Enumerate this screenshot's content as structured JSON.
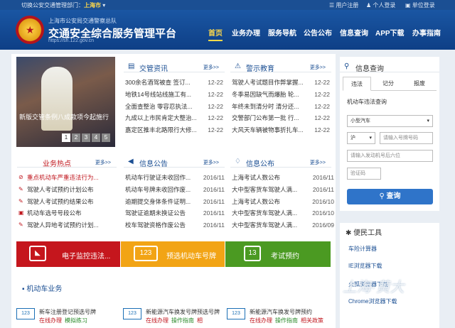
{
  "topbar": {
    "switch_label": "切换公安交通管理部门：",
    "city": "上海市",
    "links": [
      "用户注册",
      "个人登录",
      "单位登录"
    ]
  },
  "header": {
    "subtitle": "上海市公安局交通警察总队",
    "title": "交通安全综合服务管理平台",
    "url": "https://sh.122.gov.cn"
  },
  "nav": [
    "首页",
    "业务办理",
    "服务导航",
    "公告公布",
    "信息查询",
    "APP下载",
    "办事指南"
  ],
  "slider": {
    "caption": "新版交管条例八成款项今起施行",
    "pages": [
      "1",
      "2",
      "3",
      "4",
      "5"
    ]
  },
  "news": {
    "title": "交管资讯",
    "more": "更多>>",
    "rows": [
      {
        "t": "300余名酒驾被查 签订...",
        "d": "12-22"
      },
      {
        "t": "地铁14号线站线施工有...",
        "d": "12-22"
      },
      {
        "t": "全面查整治 零容忍执法...",
        "d": "12-22"
      },
      {
        "t": "九成以上市民肯定大整治...",
        "d": "12-22"
      },
      {
        "t": "嘉定区推丰北路限行大修...",
        "d": "12-22"
      }
    ]
  },
  "warn": {
    "title": "警示教育",
    "more": "更多>>",
    "rows": [
      {
        "t": "驾驶人考试题目作弊掌握...",
        "d": "12-22"
      },
      {
        "t": "冬季易因缺气而爆胎 轮...",
        "d": "12-22"
      },
      {
        "t": "年终未到清分时 清分还...",
        "d": "12-22"
      },
      {
        "t": "交警部门公布第一批 行...",
        "d": "12-22"
      },
      {
        "t": "大风天车辆被物事折扎车...",
        "d": "12-22"
      }
    ]
  },
  "hot": {
    "title": "业务热点",
    "more": "更多>>",
    "rows": [
      {
        "t": "重点机动车严重违法行为...",
        "red": true
      },
      {
        "t": "驾驶人考试预约计划公布",
        "red": false
      },
      {
        "t": "驾驶人考试预约结果公布",
        "red": false
      },
      {
        "t": "机动车选号号段公布",
        "red": false
      },
      {
        "t": "驾驶人异地考试预约计划...",
        "red": false
      }
    ]
  },
  "notice": {
    "title": "信息公告",
    "more": "更多>>",
    "rows": [
      {
        "t": "机动车行驶证未收回作...",
        "d": "2016/11"
      },
      {
        "t": "机动车号牌未收回作废...",
        "d": "2016/11"
      },
      {
        "t": "逾期提交身体条件证明...",
        "d": "2016/11"
      },
      {
        "t": "驾驶证逾期未换证公告",
        "d": "2016/11"
      },
      {
        "t": "校车驾驶资格作废公告",
        "d": "2016/11"
      }
    ]
  },
  "info": {
    "title": "信息公布",
    "more": "更多>>",
    "rows": [
      {
        "t": "上海考试人数公布",
        "d": "2016/11"
      },
      {
        "t": "大中型客货车驾驶人满...",
        "d": "2016/11"
      },
      {
        "t": "上海考试人数公布",
        "d": "2016/10"
      },
      {
        "t": "大中型客货车驾驶人满...",
        "d": "2016/10"
      },
      {
        "t": "大中型客货车驾驶人满...",
        "d": "2016/09"
      }
    ]
  },
  "banners": [
    "电子监控违法...",
    "预选机动车号牌",
    "考试预约"
  ],
  "banner_icons": [
    "",
    "123",
    ""
  ],
  "motor": {
    "title": "机动车业务",
    "items": [
      {
        "name": "新车注册登记预选号牌",
        "links": [
          "在线办理",
          "模拟练习"
        ],
        "icon": "123"
      },
      {
        "name": "新能源汽车换发号牌预选号牌",
        "links": [
          "在线办理",
          "操作指南",
          "相"
        ],
        "icon": "123"
      },
      {
        "name": "新能源汽车换发号牌预约",
        "links": [
          "在线办理",
          "操作指南",
          "相关政策"
        ],
        "icon": "123"
      }
    ]
  },
  "query": {
    "title": "信息查询",
    "tabs": [
      "违法",
      "记分",
      "报废"
    ],
    "label": "机动车违法查询",
    "vehicle_type": "小型汽车",
    "prefix": "沪",
    "plate_placeholder": "请输入号牌号码",
    "engine_placeholder": "请输入发动机号后六位",
    "captcha_placeholder": "验证码",
    "button": "查询"
  },
  "tools": {
    "title": "便民工具",
    "links": [
      "车险计算器",
      "IE浏览器下载",
      "火狐浏览器下载",
      "Chrome浏览器下载"
    ]
  },
  "watermark": "上海·黄大"
}
